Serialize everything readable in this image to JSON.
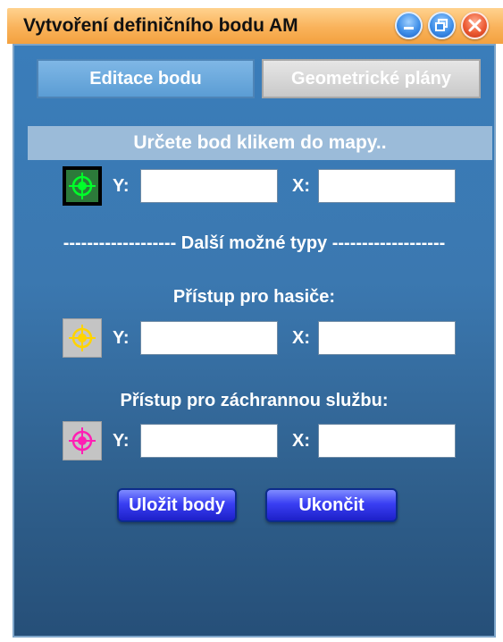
{
  "window": {
    "title": "Vytvoření definičního bodu AM"
  },
  "tabs": [
    {
      "label": "Editace bodu",
      "active": true
    },
    {
      "label": "Geometrické plány",
      "active": false
    }
  ],
  "hint": "Určete bod klikem do mapy..",
  "main_point": {
    "y_label": "Y:",
    "x_label": "X:",
    "y_value": "",
    "x_value": "",
    "marker_color": "#00ff2a"
  },
  "other_types_label": "------------------- Další možné typy -------------------",
  "firefighters": {
    "label": "Přístup pro hasiče:",
    "y_label": "Y:",
    "x_label": "X:",
    "y_value": "",
    "x_value": "",
    "marker_color": "#ffd400"
  },
  "ambulance": {
    "label": "Přístup pro záchrannou službu:",
    "y_label": "Y:",
    "x_label": "X:",
    "y_value": "",
    "x_value": "",
    "marker_color": "#ff1fb4"
  },
  "buttons": {
    "save": "Uložit body",
    "exit": "Ukončit"
  }
}
